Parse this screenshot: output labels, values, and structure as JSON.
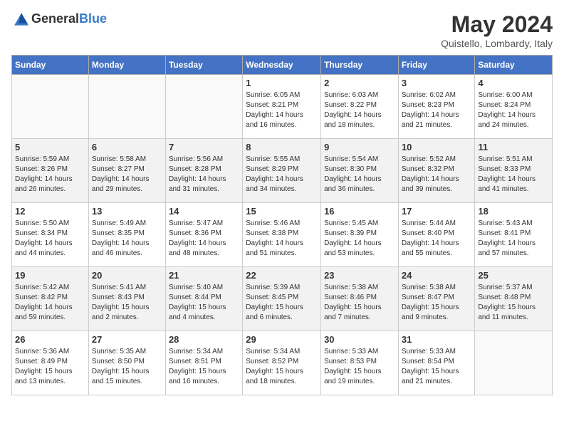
{
  "logo": {
    "text_general": "General",
    "text_blue": "Blue"
  },
  "title": "May 2024",
  "subtitle": "Quistello, Lombardy, Italy",
  "days_header": [
    "Sunday",
    "Monday",
    "Tuesday",
    "Wednesday",
    "Thursday",
    "Friday",
    "Saturday"
  ],
  "weeks": [
    [
      {
        "day": "",
        "info": ""
      },
      {
        "day": "",
        "info": ""
      },
      {
        "day": "",
        "info": ""
      },
      {
        "day": "1",
        "info": "Sunrise: 6:05 AM\nSunset: 8:21 PM\nDaylight: 14 hours\nand 16 minutes."
      },
      {
        "day": "2",
        "info": "Sunrise: 6:03 AM\nSunset: 8:22 PM\nDaylight: 14 hours\nand 18 minutes."
      },
      {
        "day": "3",
        "info": "Sunrise: 6:02 AM\nSunset: 8:23 PM\nDaylight: 14 hours\nand 21 minutes."
      },
      {
        "day": "4",
        "info": "Sunrise: 6:00 AM\nSunset: 8:24 PM\nDaylight: 14 hours\nand 24 minutes."
      }
    ],
    [
      {
        "day": "5",
        "info": "Sunrise: 5:59 AM\nSunset: 8:26 PM\nDaylight: 14 hours\nand 26 minutes."
      },
      {
        "day": "6",
        "info": "Sunrise: 5:58 AM\nSunset: 8:27 PM\nDaylight: 14 hours\nand 29 minutes."
      },
      {
        "day": "7",
        "info": "Sunrise: 5:56 AM\nSunset: 8:28 PM\nDaylight: 14 hours\nand 31 minutes."
      },
      {
        "day": "8",
        "info": "Sunrise: 5:55 AM\nSunset: 8:29 PM\nDaylight: 14 hours\nand 34 minutes."
      },
      {
        "day": "9",
        "info": "Sunrise: 5:54 AM\nSunset: 8:30 PM\nDaylight: 14 hours\nand 36 minutes."
      },
      {
        "day": "10",
        "info": "Sunrise: 5:52 AM\nSunset: 8:32 PM\nDaylight: 14 hours\nand 39 minutes."
      },
      {
        "day": "11",
        "info": "Sunrise: 5:51 AM\nSunset: 8:33 PM\nDaylight: 14 hours\nand 41 minutes."
      }
    ],
    [
      {
        "day": "12",
        "info": "Sunrise: 5:50 AM\nSunset: 8:34 PM\nDaylight: 14 hours\nand 44 minutes."
      },
      {
        "day": "13",
        "info": "Sunrise: 5:49 AM\nSunset: 8:35 PM\nDaylight: 14 hours\nand 46 minutes."
      },
      {
        "day": "14",
        "info": "Sunrise: 5:47 AM\nSunset: 8:36 PM\nDaylight: 14 hours\nand 48 minutes."
      },
      {
        "day": "15",
        "info": "Sunrise: 5:46 AM\nSunset: 8:38 PM\nDaylight: 14 hours\nand 51 minutes."
      },
      {
        "day": "16",
        "info": "Sunrise: 5:45 AM\nSunset: 8:39 PM\nDaylight: 14 hours\nand 53 minutes."
      },
      {
        "day": "17",
        "info": "Sunrise: 5:44 AM\nSunset: 8:40 PM\nDaylight: 14 hours\nand 55 minutes."
      },
      {
        "day": "18",
        "info": "Sunrise: 5:43 AM\nSunset: 8:41 PM\nDaylight: 14 hours\nand 57 minutes."
      }
    ],
    [
      {
        "day": "19",
        "info": "Sunrise: 5:42 AM\nSunset: 8:42 PM\nDaylight: 14 hours\nand 59 minutes."
      },
      {
        "day": "20",
        "info": "Sunrise: 5:41 AM\nSunset: 8:43 PM\nDaylight: 15 hours\nand 2 minutes."
      },
      {
        "day": "21",
        "info": "Sunrise: 5:40 AM\nSunset: 8:44 PM\nDaylight: 15 hours\nand 4 minutes."
      },
      {
        "day": "22",
        "info": "Sunrise: 5:39 AM\nSunset: 8:45 PM\nDaylight: 15 hours\nand 6 minutes."
      },
      {
        "day": "23",
        "info": "Sunrise: 5:38 AM\nSunset: 8:46 PM\nDaylight: 15 hours\nand 7 minutes."
      },
      {
        "day": "24",
        "info": "Sunrise: 5:38 AM\nSunset: 8:47 PM\nDaylight: 15 hours\nand 9 minutes."
      },
      {
        "day": "25",
        "info": "Sunrise: 5:37 AM\nSunset: 8:48 PM\nDaylight: 15 hours\nand 11 minutes."
      }
    ],
    [
      {
        "day": "26",
        "info": "Sunrise: 5:36 AM\nSunset: 8:49 PM\nDaylight: 15 hours\nand 13 minutes."
      },
      {
        "day": "27",
        "info": "Sunrise: 5:35 AM\nSunset: 8:50 PM\nDaylight: 15 hours\nand 15 minutes."
      },
      {
        "day": "28",
        "info": "Sunrise: 5:34 AM\nSunset: 8:51 PM\nDaylight: 15 hours\nand 16 minutes."
      },
      {
        "day": "29",
        "info": "Sunrise: 5:34 AM\nSunset: 8:52 PM\nDaylight: 15 hours\nand 18 minutes."
      },
      {
        "day": "30",
        "info": "Sunrise: 5:33 AM\nSunset: 8:53 PM\nDaylight: 15 hours\nand 19 minutes."
      },
      {
        "day": "31",
        "info": "Sunrise: 5:33 AM\nSunset: 8:54 PM\nDaylight: 15 hours\nand 21 minutes."
      },
      {
        "day": "",
        "info": ""
      }
    ]
  ]
}
